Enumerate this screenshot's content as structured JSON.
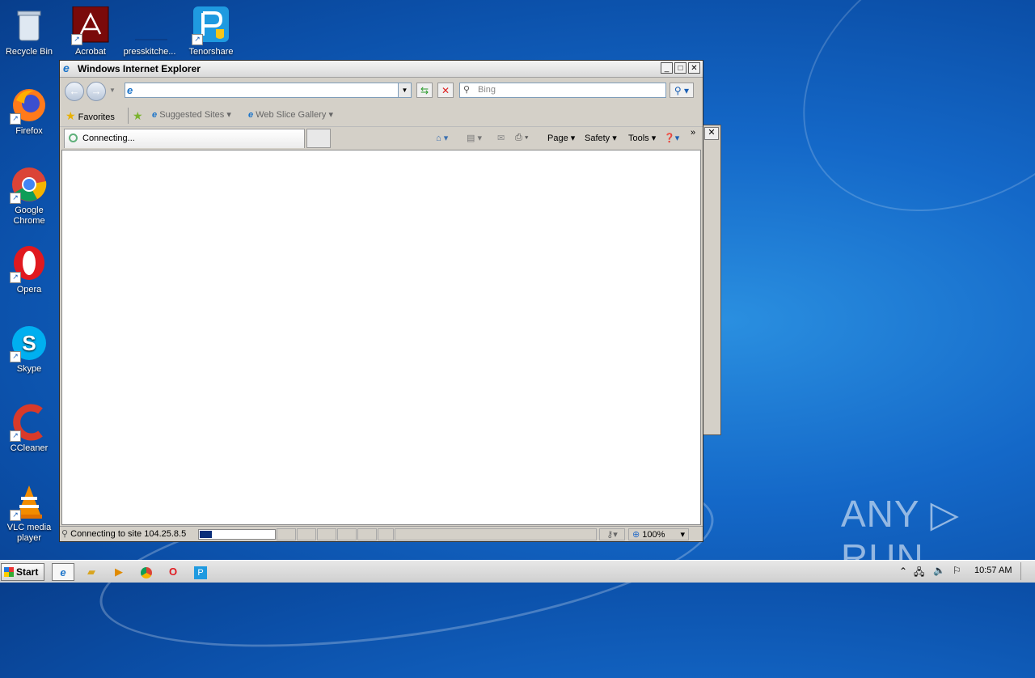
{
  "desktop": {
    "icons": [
      {
        "label": "Recycle Bin",
        "icon": "recycle-bin-icon"
      },
      {
        "label": "Acrobat",
        "icon": "acrobat-icon"
      },
      {
        "label": "presskitche...",
        "icon": "file-icon"
      },
      {
        "label": "Tenorshare",
        "icon": "tenorshare-icon"
      },
      {
        "label": "Firefox",
        "icon": "firefox-icon"
      },
      {
        "label": "Google Chrome",
        "icon": "chrome-icon"
      },
      {
        "label": "Opera",
        "icon": "opera-icon"
      },
      {
        "label": "Skype",
        "icon": "skype-icon"
      },
      {
        "label": "CCleaner",
        "icon": "ccleaner-icon"
      },
      {
        "label": "VLC media player",
        "icon": "vlc-icon"
      }
    ],
    "watermark": "ANY ▷ RUN"
  },
  "ie": {
    "title": "Windows Internet Explorer",
    "address": "",
    "search_placeholder": "Bing",
    "favorites_label": "Favorites",
    "suggested_sites": "Suggested Sites",
    "web_slice_gallery": "Web Slice Gallery",
    "tab_label": "Connecting...",
    "cmd": {
      "page": "Page",
      "safety": "Safety",
      "tools": "Tools"
    },
    "status_text": "Connecting to site 104.25.8.5",
    "zoom": "100%",
    "progress_fraction": 0.16
  },
  "taskbar": {
    "start_label": "Start",
    "clock": "10:57 AM"
  },
  "colors": {
    "desktop": "#1468c8",
    "progress": "#0a2e7a"
  }
}
